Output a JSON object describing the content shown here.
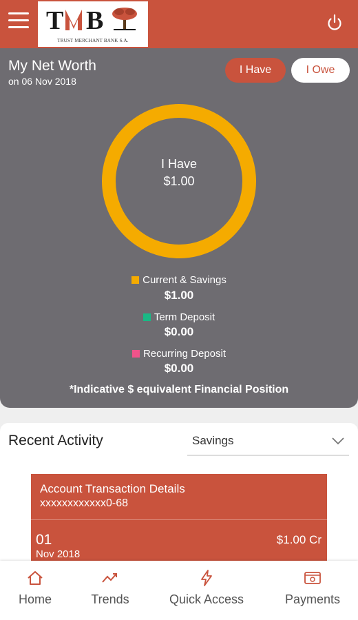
{
  "header": {
    "logo_lettering": "TMB",
    "logo_text": "TRUST MERCHANT BANK S.A."
  },
  "net_worth": {
    "title": "My Net Worth",
    "date": "on 06 Nov 2018",
    "toggle_have": "I Have",
    "toggle_owe": "I Owe",
    "center_label": "I Have",
    "center_value": "$1.00",
    "ring_color": "#f5ab00",
    "legend": [
      {
        "label": "Current & Savings",
        "value": "$1.00",
        "color": "#f5ab00"
      },
      {
        "label": "Term Deposit",
        "value": "$0.00",
        "color": "#19b985"
      },
      {
        "label": "Recurring Deposit",
        "value": "$0.00",
        "color": "#f0538a"
      }
    ],
    "footnote": "*Indicative $ equivalent Financial Position"
  },
  "activity": {
    "title": "Recent Activity",
    "account_type": "Savings",
    "card_title": "Account Transaction Details",
    "account_number": "xxxxxxxxxxxx0-68",
    "day": "01",
    "month": "Nov 2018",
    "amount": "$1.00 Cr"
  },
  "nav": {
    "home": "Home",
    "trends": "Trends",
    "quick_access": "Quick Access",
    "payments": "Payments"
  },
  "colors": {
    "brand": "#c9533d",
    "card_gray": "#6e6c71"
  }
}
